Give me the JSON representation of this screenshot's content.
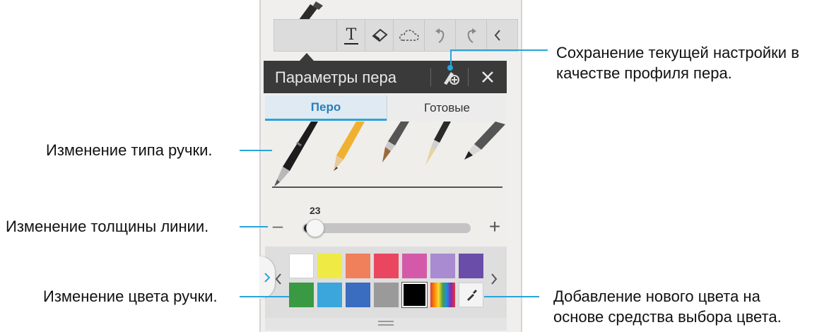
{
  "toolbar": {
    "icons": [
      "pen-icon",
      "text-icon",
      "eraser-icon",
      "cloud-select-icon",
      "undo-icon",
      "redo-icon",
      "collapse-chevron-icon"
    ]
  },
  "panel": {
    "title": "Параметры пера",
    "tabs": [
      {
        "label": "Перо",
        "active": true
      },
      {
        "label": "Готовые",
        "active": false
      }
    ],
    "pen_types": [
      "ballpoint-pen",
      "pencil",
      "brush-pen",
      "fine-brush",
      "marker-pen"
    ],
    "thickness": {
      "value_label": "23",
      "minus": "–",
      "plus": "+"
    },
    "colors_row1": [
      "#ffffff",
      "#f0ea45",
      "#f07f5c",
      "#ea4660",
      "#d45aa9",
      "#a88bd0",
      "#6a4da8"
    ],
    "colors_row2": [
      "#3a9a44",
      "#3aa6dc",
      "#3a6cc0",
      "#9a9a9a",
      "#000000"
    ],
    "accent": "#2aa4d8"
  },
  "callouts": {
    "save_profile": [
      "Сохранение текущей настройки в",
      "качестве профиля пера."
    ],
    "pen_type": "Изменение типа ручки.",
    "thickness": "Изменение толщины линии.",
    "color": "Изменение цвета ручки.",
    "add_color": [
      "Добавление нового цвета на",
      "основе средства выбора цвета."
    ]
  }
}
